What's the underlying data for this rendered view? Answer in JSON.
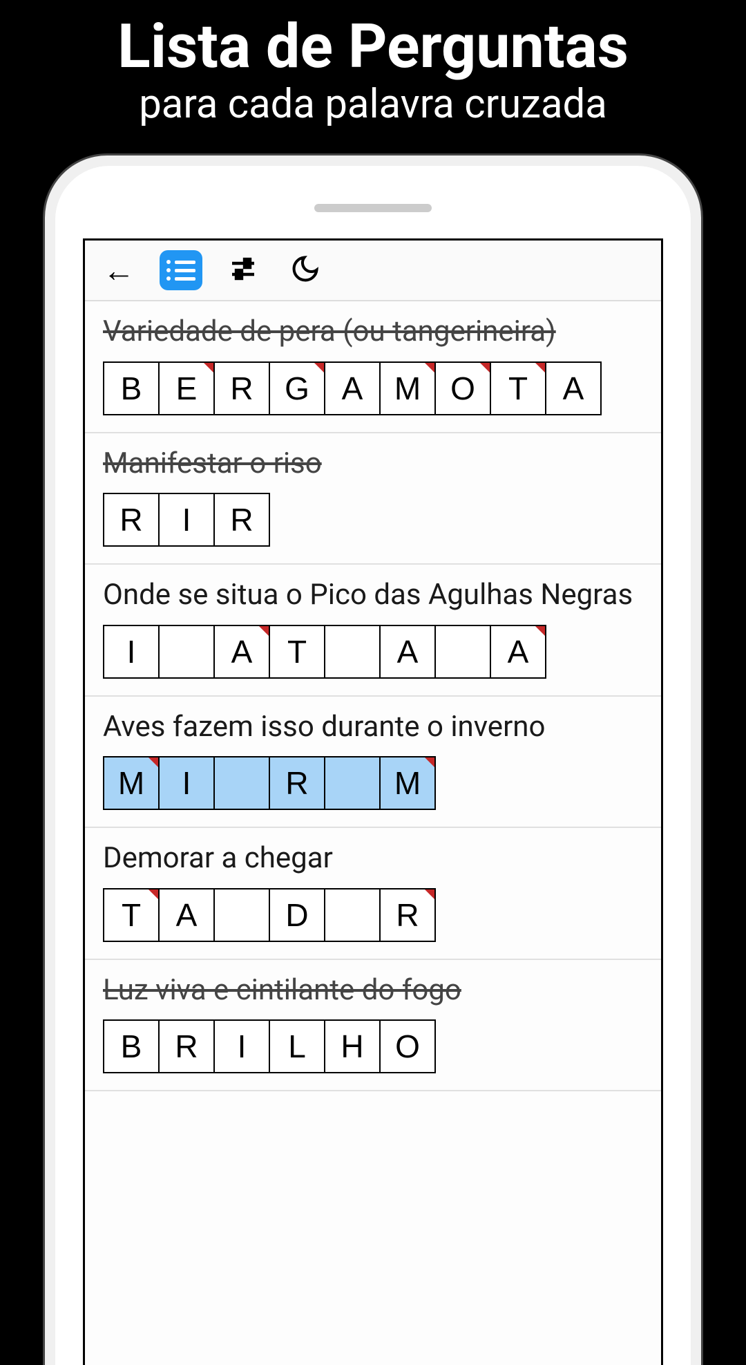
{
  "promo": {
    "title": "Lista de Perguntas",
    "subtitle": "para cada palavra cruzada"
  },
  "toolbar": {
    "back": "←"
  },
  "clues": [
    {
      "text": "Variedade de pera (ou tangerineira)",
      "completed": true,
      "highlighted": false,
      "cells": [
        {
          "letter": "B",
          "marked": false
        },
        {
          "letter": "E",
          "marked": true
        },
        {
          "letter": "R",
          "marked": false
        },
        {
          "letter": "G",
          "marked": true
        },
        {
          "letter": "A",
          "marked": false
        },
        {
          "letter": "M",
          "marked": true
        },
        {
          "letter": "O",
          "marked": true
        },
        {
          "letter": "T",
          "marked": true
        },
        {
          "letter": "A",
          "marked": false
        }
      ]
    },
    {
      "text": "Manifestar o riso",
      "completed": true,
      "highlighted": false,
      "cells": [
        {
          "letter": "R",
          "marked": false
        },
        {
          "letter": "I",
          "marked": false
        },
        {
          "letter": "R",
          "marked": false
        }
      ]
    },
    {
      "text": "Onde se situa o Pico das Agulhas Negras",
      "completed": false,
      "highlighted": false,
      "cells": [
        {
          "letter": "I",
          "marked": false
        },
        {
          "letter": "",
          "marked": false
        },
        {
          "letter": "A",
          "marked": true
        },
        {
          "letter": "T",
          "marked": false
        },
        {
          "letter": "",
          "marked": false
        },
        {
          "letter": "A",
          "marked": false
        },
        {
          "letter": "",
          "marked": false
        },
        {
          "letter": "A",
          "marked": true
        }
      ]
    },
    {
      "text": "Aves fazem isso durante o inverno",
      "completed": false,
      "highlighted": true,
      "cells": [
        {
          "letter": "M",
          "marked": true
        },
        {
          "letter": "I",
          "marked": false
        },
        {
          "letter": "",
          "marked": false
        },
        {
          "letter": "R",
          "marked": false
        },
        {
          "letter": "",
          "marked": false
        },
        {
          "letter": "M",
          "marked": true
        }
      ]
    },
    {
      "text": "Demorar a chegar",
      "completed": false,
      "highlighted": false,
      "cells": [
        {
          "letter": "T",
          "marked": true
        },
        {
          "letter": "A",
          "marked": false
        },
        {
          "letter": "",
          "marked": false
        },
        {
          "letter": "D",
          "marked": false
        },
        {
          "letter": "",
          "marked": false
        },
        {
          "letter": "R",
          "marked": true
        }
      ]
    },
    {
      "text": "Luz viva e cintilante do fogo",
      "completed": true,
      "highlighted": false,
      "cells": [
        {
          "letter": "B",
          "marked": false
        },
        {
          "letter": "R",
          "marked": false
        },
        {
          "letter": "I",
          "marked": false
        },
        {
          "letter": "L",
          "marked": false
        },
        {
          "letter": "H",
          "marked": false
        },
        {
          "letter": "O",
          "marked": false
        }
      ]
    }
  ]
}
